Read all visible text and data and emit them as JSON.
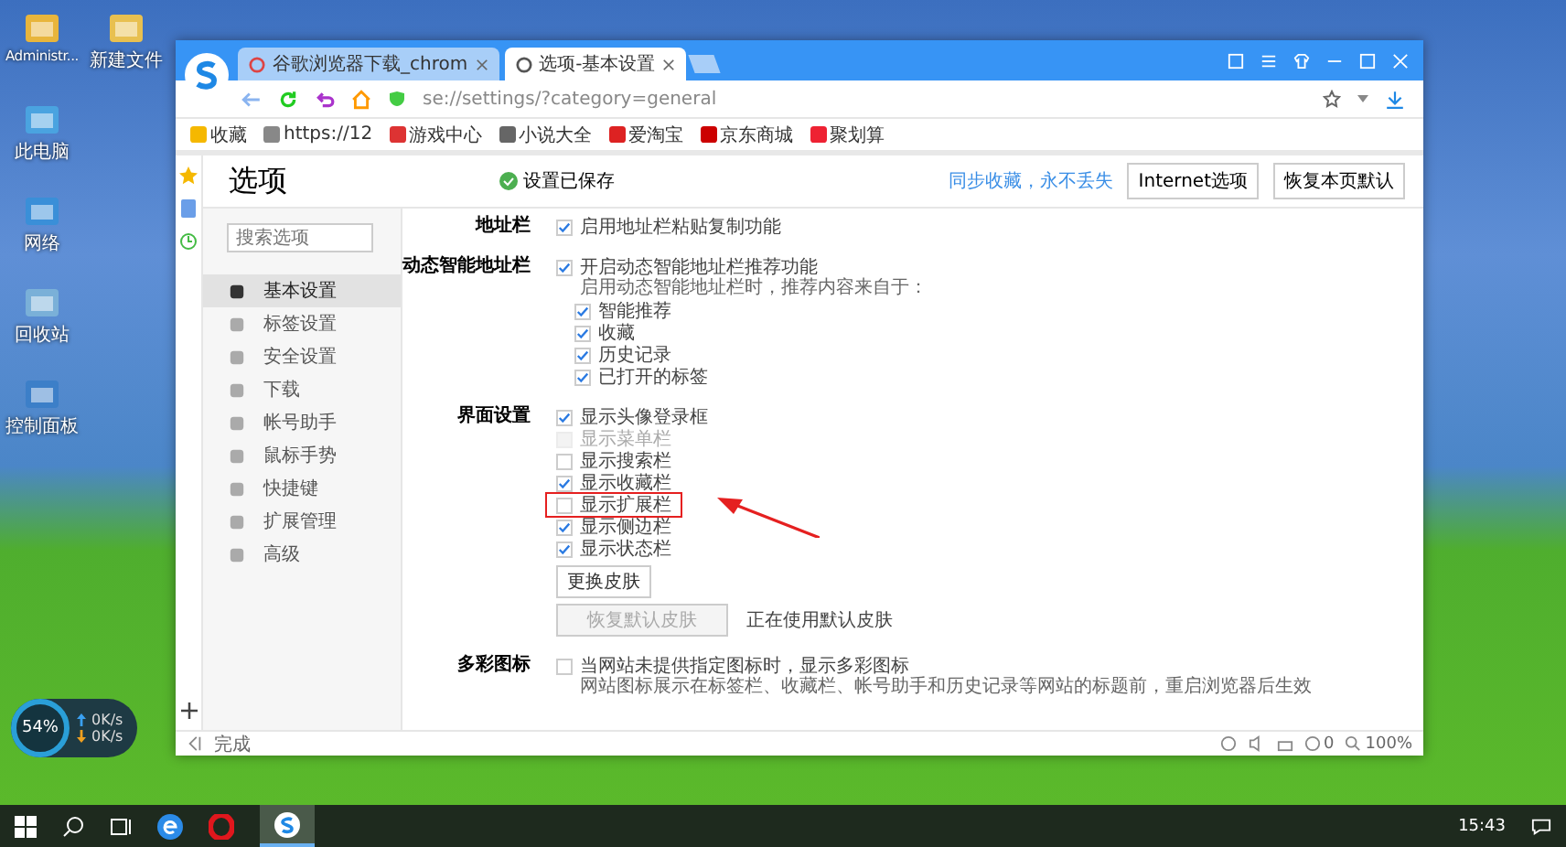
{
  "desktop_icons": [
    {
      "label": "Administr..."
    },
    {
      "label": "新建文件"
    },
    {
      "label": "此电脑"
    },
    {
      "label": "网络"
    },
    {
      "label": "回收站"
    },
    {
      "label": "控制面板"
    }
  ],
  "browser": {
    "tabs": [
      {
        "title": "谷歌浏览器下载_chrom",
        "selected": false
      },
      {
        "title": "选项-基本设置",
        "selected": true
      }
    ],
    "address": "se://settings/?category=general",
    "bookmarks": [
      "收藏",
      "https://12",
      "游戏中心",
      "小说大全",
      "爱淘宝",
      "京东商城",
      "聚划算"
    ]
  },
  "page": {
    "title": "选项",
    "save_status": "设置已保存",
    "sync_link": "同步收藏，永不丢失",
    "buttons": [
      "Internet选项",
      "恢复本页默认"
    ]
  },
  "search": {
    "placeholder": "搜索选项"
  },
  "nav": [
    {
      "label": "基本设置",
      "selected": true
    },
    {
      "label": "标签设置",
      "selected": false
    },
    {
      "label": "安全设置",
      "selected": false
    },
    {
      "label": "下载",
      "selected": false
    },
    {
      "label": "帐号助手",
      "selected": false
    },
    {
      "label": "鼠标手势",
      "selected": false
    },
    {
      "label": "快捷键",
      "selected": false
    },
    {
      "label": "扩展管理",
      "selected": false
    },
    {
      "label": "高级",
      "selected": false
    }
  ],
  "sections": [
    {
      "label": "地址栏",
      "items": [
        {
          "kind": "checkbox",
          "label": "启用地址栏粘贴复制功能",
          "checked": true,
          "disabled": false,
          "highlighted": false
        }
      ]
    },
    {
      "label": "动态智能地址栏",
      "items": [
        {
          "kind": "checkbox",
          "label": "开启动态智能地址栏推荐功能",
          "checked": true,
          "disabled": false,
          "highlighted": false,
          "hint": "启用动态智能地址栏时，推荐内容来自于：",
          "children": [
            {
              "label": "智能推荐",
              "checked": true
            },
            {
              "label": "收藏",
              "checked": true
            },
            {
              "label": "历史记录",
              "checked": true
            },
            {
              "label": "已打开的标签",
              "checked": true
            }
          ]
        }
      ]
    },
    {
      "label": "界面设置",
      "items": [
        {
          "kind": "checkbox",
          "label": "显示头像登录框",
          "checked": true,
          "disabled": false,
          "highlighted": false
        },
        {
          "kind": "checkbox",
          "label": "显示菜单栏",
          "checked": false,
          "disabled": true,
          "highlighted": false
        },
        {
          "kind": "checkbox",
          "label": "显示搜索栏",
          "checked": false,
          "disabled": false,
          "highlighted": false
        },
        {
          "kind": "checkbox",
          "label": "显示收藏栏",
          "checked": true,
          "disabled": false,
          "highlighted": false
        },
        {
          "kind": "checkbox",
          "label": "显示扩展栏",
          "checked": false,
          "disabled": false,
          "highlighted": true
        },
        {
          "kind": "checkbox",
          "label": "显示侧边栏",
          "checked": true,
          "disabled": false,
          "highlighted": false
        },
        {
          "kind": "checkbox",
          "label": "显示状态栏",
          "checked": true,
          "disabled": false,
          "highlighted": false
        },
        {
          "kind": "button",
          "label": "更换皮肤",
          "disabled": false
        },
        {
          "kind": "button",
          "label": "恢复默认皮肤",
          "disabled": true,
          "note": "正在使用默认皮肤"
        }
      ]
    },
    {
      "label": "多彩图标",
      "items": [
        {
          "kind": "checkbox",
          "label": "当网站未提供指定图标时，显示多彩图标",
          "checked": false,
          "disabled": false,
          "highlighted": false,
          "hint": "网站图标展示在标签栏、收藏栏、帐号助手和历史记录等网站的标题前，重启浏览器后生效"
        }
      ]
    }
  ],
  "status_bar": {
    "text": "完成",
    "count": "0",
    "zoom": "100%"
  },
  "widget": {
    "percent": "54%",
    "upload": "0K/s",
    "download": "0K/s"
  },
  "taskbar": {
    "clock": "15:43"
  }
}
